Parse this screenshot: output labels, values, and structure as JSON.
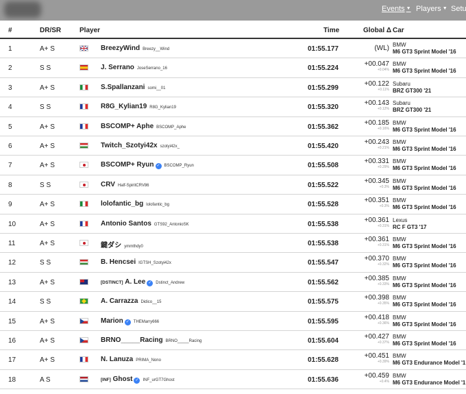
{
  "nav": {
    "events": "Events",
    "players": "Players",
    "setup": "Setu"
  },
  "table": {
    "headers": {
      "pos": "#",
      "rating": "DR/SR",
      "player": "Player",
      "time": "Time",
      "gap": "Global Δ",
      "car": "Car"
    },
    "rows": [
      {
        "pos": "1",
        "rating": "A+ S",
        "flag": "gb",
        "tag": "",
        "name": "BreezyWind",
        "verified": false,
        "id": "Breezy__Wind",
        "time": "01:55.177",
        "gap": "(WL)",
        "gap_pct": "",
        "car_make": "BMW",
        "car_model": "M6 GT3 Sprint Model '16"
      },
      {
        "pos": "2",
        "rating": "S S",
        "flag": "es",
        "tag": "",
        "name": "J. Serrano",
        "verified": false,
        "id": "JoseSerrano_16",
        "time": "01:55.224",
        "gap": "+00.047",
        "gap_pct": "+0.04%",
        "car_make": "BMW",
        "car_model": "M6 GT3 Sprint Model '16"
      },
      {
        "pos": "3",
        "rating": "A+ S",
        "flag": "it",
        "tag": "",
        "name": "S.Spallanzani",
        "verified": false,
        "id": "somi__01",
        "time": "01:55.299",
        "gap": "+00.122",
        "gap_pct": "+0.11%",
        "car_make": "Subaru",
        "car_model": "BRZ GT300 '21"
      },
      {
        "pos": "4",
        "rating": "S S",
        "flag": "fr",
        "tag": "",
        "name": "R8G_Kylian19",
        "verified": false,
        "id": "R8G_Kylian19",
        "time": "01:55.320",
        "gap": "+00.143",
        "gap_pct": "+0.12%",
        "car_make": "Subaru",
        "car_model": "BRZ GT300 '21"
      },
      {
        "pos": "5",
        "rating": "A+ S",
        "flag": "fr",
        "tag": "",
        "name": "BSCOMP+ Aphe",
        "verified": false,
        "id": "BSCOMP_Aphe",
        "time": "01:55.362",
        "gap": "+00.185",
        "gap_pct": "+0.16%",
        "car_make": "BMW",
        "car_model": "M6 GT3 Sprint Model '16"
      },
      {
        "pos": "6",
        "rating": "A+ S",
        "flag": "hu",
        "tag": "",
        "name": "Twitch_Szotyi42x",
        "verified": false,
        "id": "szotyi42x_",
        "time": "01:55.420",
        "gap": "+00.243",
        "gap_pct": "+0.21%",
        "car_make": "BMW",
        "car_model": "M6 GT3 Sprint Model '16"
      },
      {
        "pos": "7",
        "rating": "A+ S",
        "flag": "jp",
        "tag": "",
        "name": "BSCOMP+ Ryun",
        "verified": true,
        "id": "BSCOMP_Ryun",
        "time": "01:55.508",
        "gap": "+00.331",
        "gap_pct": "+0.29%",
        "car_make": "BMW",
        "car_model": "M6 GT3 Sprint Model '16"
      },
      {
        "pos": "8",
        "rating": "S S",
        "flag": "jp",
        "tag": "",
        "name": "CRV",
        "verified": false,
        "id": "Half-SpiritCRV86",
        "time": "01:55.522",
        "gap": "+00.345",
        "gap_pct": "+0.3%",
        "car_make": "BMW",
        "car_model": "M6 GT3 Sprint Model '16"
      },
      {
        "pos": "9",
        "rating": "A+ S",
        "flag": "it",
        "tag": "",
        "name": "lolofantic_bg",
        "verified": false,
        "id": "lolofantic_bg",
        "time": "01:55.528",
        "gap": "+00.351",
        "gap_pct": "+0.3%",
        "car_make": "BMW",
        "car_model": "M6 GT3 Sprint Model '16"
      },
      {
        "pos": "10",
        "rating": "A+ S",
        "flag": "fr",
        "tag": "",
        "name": "Antonio Santos",
        "verified": false,
        "id": "GTS92_AntonioSK",
        "time": "01:55.538",
        "gap": "+00.361",
        "gap_pct": "+0.31%",
        "car_make": "Lexus",
        "car_model": "RC F GT3 '17"
      },
      {
        "pos": "11",
        "rating": "A+ S",
        "flag": "jp",
        "tag": "",
        "name": "鍵ダシ",
        "verified": false,
        "id": "ymmthdy0",
        "time": "01:55.538",
        "gap": "+00.361",
        "gap_pct": "+0.31%",
        "car_make": "BMW",
        "car_model": "M6 GT3 Sprint Model '16"
      },
      {
        "pos": "12",
        "rating": "S S",
        "flag": "hu",
        "tag": "",
        "name": "B. Hencsei",
        "verified": false,
        "id": "IGTSH_Szotyi42x",
        "time": "01:55.547",
        "gap": "+00.370",
        "gap_pct": "+0.32%",
        "car_make": "BMW",
        "car_model": "M6 GT3 Sprint Model '16"
      },
      {
        "pos": "13",
        "rating": "A+ S",
        "flag": "au",
        "tag": "[DSTINCT]",
        "name": "A. Lee",
        "verified": true,
        "id": "Dstinct_Andrew",
        "time": "01:55.562",
        "gap": "+00.385",
        "gap_pct": "+0.33%",
        "car_make": "BMW",
        "car_model": "M6 GT3 Sprint Model '16"
      },
      {
        "pos": "14",
        "rating": "S S",
        "flag": "br",
        "tag": "",
        "name": "A. Carrazza",
        "verified": false,
        "id": "Didico__15",
        "time": "01:55.575",
        "gap": "+00.398",
        "gap_pct": "+0.35%",
        "car_make": "BMW",
        "car_model": "M6 GT3 Sprint Model '16"
      },
      {
        "pos": "15",
        "rating": "A+ S",
        "flag": "cz",
        "tag": "",
        "name": "Marion",
        "verified": true,
        "id": "THEMarry666",
        "time": "01:55.595",
        "gap": "+00.418",
        "gap_pct": "+0.36%",
        "car_make": "BMW",
        "car_model": "M6 GT3 Sprint Model '16"
      },
      {
        "pos": "16",
        "rating": "A+ S",
        "flag": "cz",
        "tag": "",
        "name": "BRNO_____Racing",
        "verified": false,
        "id": "BRNO_____Racing",
        "time": "01:55.604",
        "gap": "+00.427",
        "gap_pct": "+0.37%",
        "car_make": "BMW",
        "car_model": "M6 GT3 Sprint Model '16"
      },
      {
        "pos": "17",
        "rating": "A+ S",
        "flag": "fr",
        "tag": "",
        "name": "N. Lanuza",
        "verified": false,
        "id": "PRIMA_Nono",
        "time": "01:55.628",
        "gap": "+00.451",
        "gap_pct": "+0.39%",
        "car_make": "BMW",
        "car_model": "M6 GT3 Endurance Model '1"
      },
      {
        "pos": "18",
        "rating": "A S",
        "flag": "nl",
        "tag": "[INF]",
        "name": "Ghost",
        "verified": true,
        "id": "INF_urGT7Ghost",
        "time": "01:55.636",
        "gap": "+00.459",
        "gap_pct": "+0.4%",
        "car_make": "BMW",
        "car_model": "M6 GT3 Endurance Model '1"
      }
    ]
  }
}
